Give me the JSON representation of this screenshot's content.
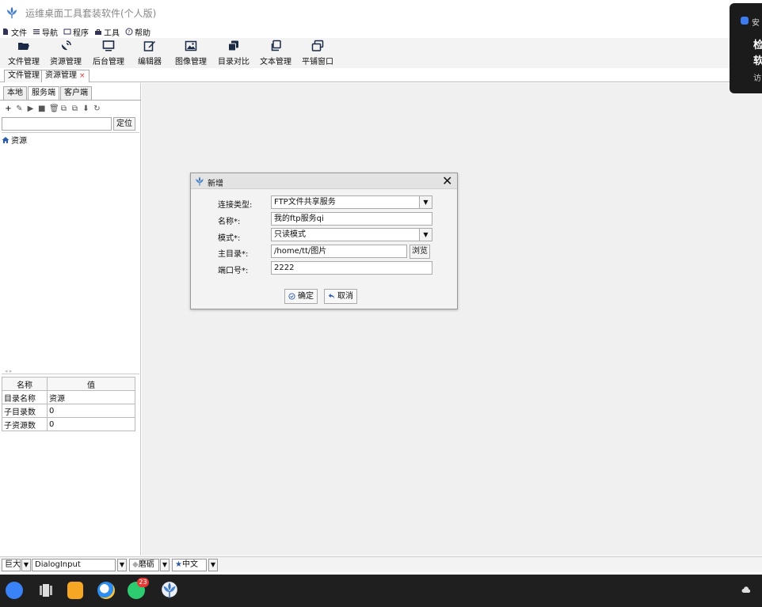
{
  "window": {
    "title": "运维桌面工具套装软件(个人版)",
    "logo_icon": "tulip-logo-icon"
  },
  "menu": [
    {
      "label": "文件",
      "icon": "file-icon"
    },
    {
      "label": "导航",
      "icon": "list-icon"
    },
    {
      "label": "程序",
      "icon": "program-icon"
    },
    {
      "label": "工具",
      "icon": "toolbox-icon"
    },
    {
      "label": "帮助",
      "icon": "help-icon"
    }
  ],
  "toolbar": [
    {
      "label": "文件管理",
      "icon": "folder-open-icon"
    },
    {
      "label": "资源管理",
      "icon": "satellite-icon"
    },
    {
      "label": "后台管理",
      "icon": "monitor-icon"
    },
    {
      "label": "编辑器",
      "icon": "edit-icon"
    },
    {
      "label": "图像管理",
      "icon": "image-icon"
    },
    {
      "label": "目录对比",
      "icon": "copy-icon"
    },
    {
      "label": "文本管理",
      "icon": "clone-icon"
    },
    {
      "label": "平铺窗口",
      "icon": "window-icon"
    }
  ],
  "doc_tabs": [
    {
      "label": "文件管理",
      "active": false
    },
    {
      "label": "资源管理",
      "active": true,
      "close": "×"
    }
  ],
  "left_panel": {
    "tabs": [
      "本地",
      "服务端",
      "客户端"
    ],
    "active_tab": 1,
    "tools": [
      "+",
      "✎",
      "▶",
      "■",
      "🗑",
      "⧉",
      "⧉",
      "⬇",
      "↻"
    ],
    "search": {
      "value": "",
      "placeholder": ""
    },
    "locate_label": "定位",
    "tree_root": {
      "label": "资源",
      "icon": "home-icon"
    },
    "splitter_glyph": "◂ ▸",
    "properties": {
      "headers": [
        "名称",
        "值"
      ],
      "rows": [
        [
          "目录名称",
          "资源"
        ],
        [
          "子目录数",
          "0"
        ],
        [
          "子资源数",
          "0"
        ]
      ]
    }
  },
  "dialog": {
    "title": "新增",
    "close": "✕",
    "fields": {
      "type_label": "连接类型:",
      "type_value": "FTP文件共享服务",
      "name_label": "名称*:",
      "name_value": "我的ftp服务qi",
      "mode_label": "模式*:",
      "mode_value": "只读模式",
      "dir_label": "主目录*:",
      "dir_value": "/home/tt/图片",
      "browse_label": "浏览",
      "port_label": "端口号*:",
      "port_value": "2222"
    },
    "ok_label": "确定",
    "cancel_label": "取消"
  },
  "status_bar": {
    "size_value": "巨大",
    "font_value": "DialogInput",
    "theme_value": "磨砺",
    "lang_value": "中文",
    "arrow": "▼"
  },
  "taskbar": {
    "badge": "23",
    "tray_icon": "cloud-icon"
  },
  "notification": {
    "line1": "安",
    "line2": "检",
    "line3": "软",
    "line4": "访"
  },
  "colors": {
    "accent": "#3d7bf0",
    "badge": "#e53935",
    "taskbar": "#1f1f1f"
  }
}
